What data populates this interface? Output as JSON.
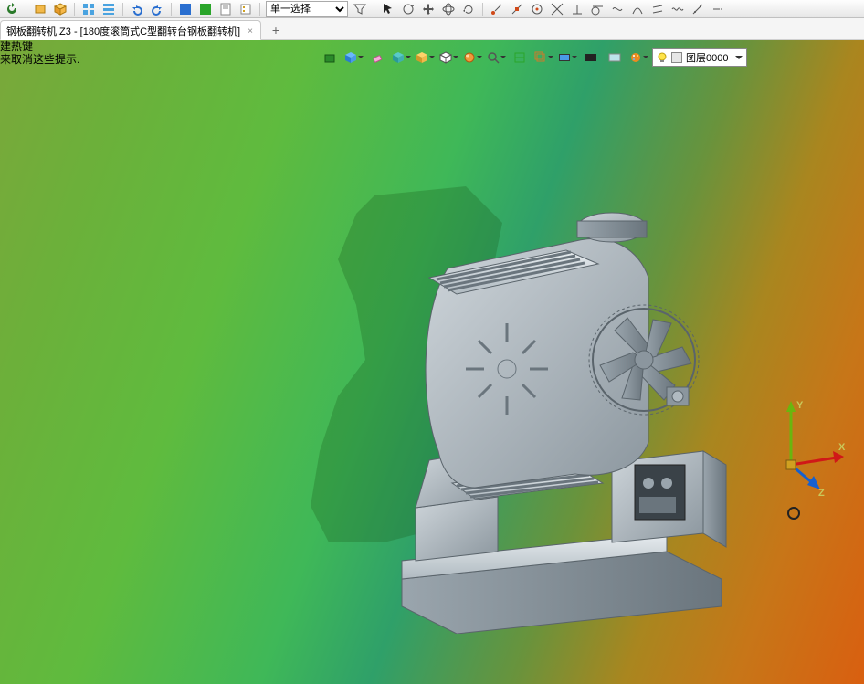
{
  "topbar": {
    "select_mode": "单一选择",
    "select_options": [
      "单一选择"
    ]
  },
  "tabs": [
    {
      "label": "钢板翻转机.Z3 - [180度滚筒式C型翻转台钢板翻转机]"
    }
  ],
  "tips": {
    "line1": "建热键",
    "line2": "来取消这些提示."
  },
  "layer": {
    "name": "图层0000"
  },
  "axes": {
    "x": "X",
    "y": "Y",
    "z": "Z"
  },
  "colors": {
    "axis_x": "#d01818",
    "axis_y": "#6ab60e",
    "axis_z": "#1560d0"
  }
}
